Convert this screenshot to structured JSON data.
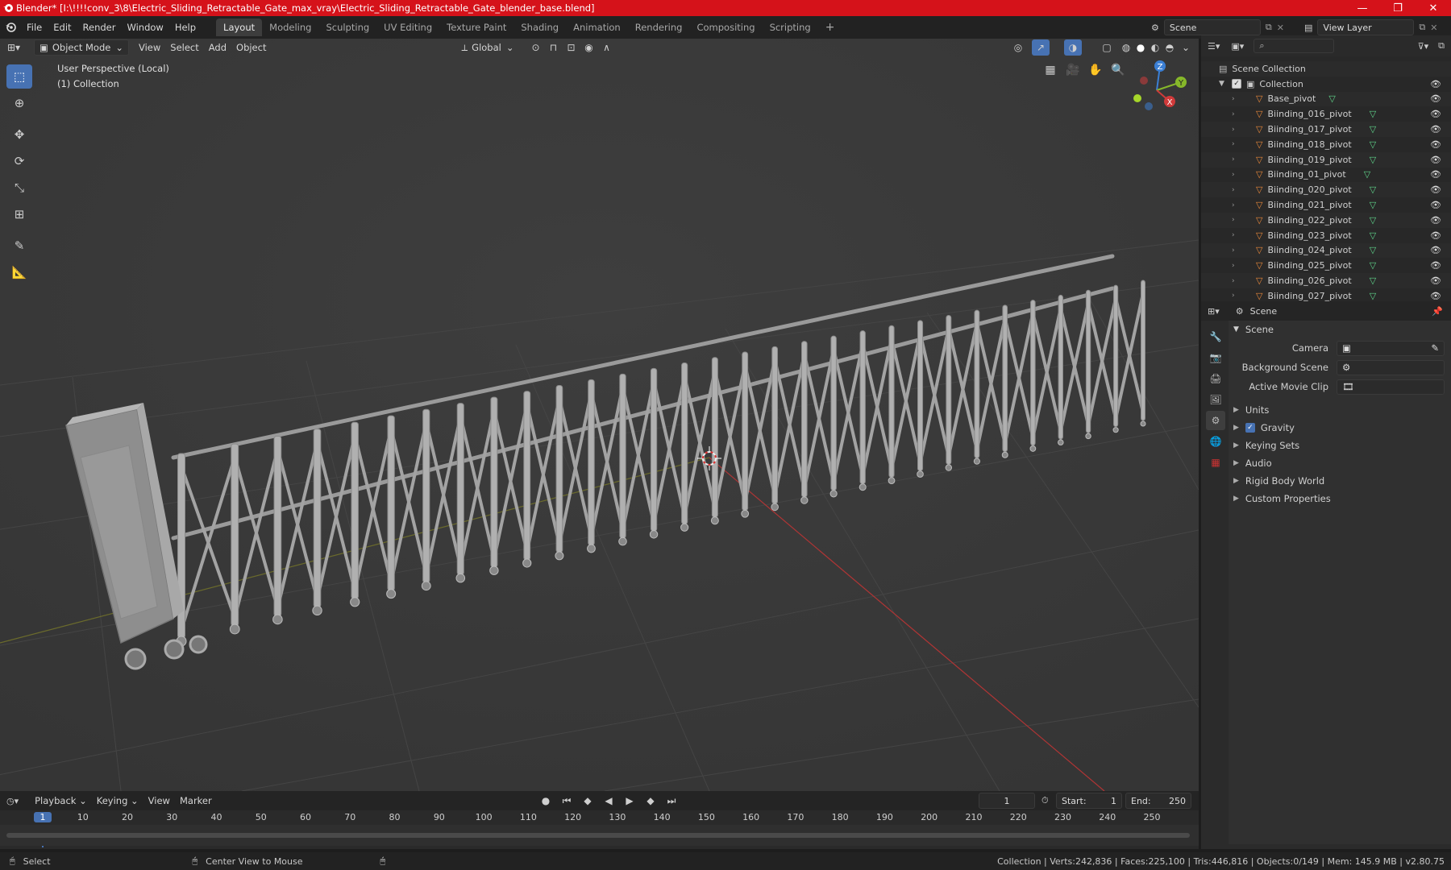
{
  "title_bar": {
    "text": "Blender* [I:\\!!!!conv_3\\8\\Electric_Sliding_Retractable_Gate_max_vray\\Electric_Sliding_Retractable_Gate_blender_base.blend]",
    "minimize": "—",
    "restore": "❐",
    "close": "✕"
  },
  "menu": [
    "File",
    "Edit",
    "Render",
    "Window",
    "Help"
  ],
  "workspaces": [
    "Layout",
    "Modeling",
    "Sculpting",
    "UV Editing",
    "Texture Paint",
    "Shading",
    "Animation",
    "Rendering",
    "Compositing",
    "Scripting"
  ],
  "workspace_add": "+",
  "scene_selector": "Scene",
  "view_layer_selector": "View Layer",
  "viewport": {
    "mode": "Object Mode",
    "menus": [
      "View",
      "Select",
      "Add",
      "Object"
    ],
    "orientation": "Global",
    "overlay_line1": "User Perspective (Local)",
    "overlay_line2": "(1) Collection",
    "gizmo_axes": {
      "z": "Z",
      "y": "Y",
      "x": "X"
    }
  },
  "outliner": {
    "scene_collection": "Scene Collection",
    "collection": "Collection",
    "items": [
      "Base_pivot",
      "Biinding_016_pivot",
      "Biinding_017_pivot",
      "Biinding_018_pivot",
      "Biinding_019_pivot",
      "Biinding_01_pivot",
      "Biinding_020_pivot",
      "Biinding_021_pivot",
      "Biinding_022_pivot",
      "Biinding_023_pivot",
      "Biinding_024_pivot",
      "Biinding_025_pivot",
      "Biinding_026_pivot",
      "Biinding_027_pivot"
    ]
  },
  "properties": {
    "context": "Scene",
    "section": "Scene",
    "fields": [
      {
        "label": "Camera"
      },
      {
        "label": "Background Scene"
      },
      {
        "label": "Active Movie Clip"
      }
    ],
    "panels": [
      "Units",
      "Gravity",
      "Keying Sets",
      "Audio",
      "Rigid Body World",
      "Custom Properties"
    ]
  },
  "timeline": {
    "menus": [
      "Playback",
      "Keying",
      "View",
      "Marker"
    ],
    "current_frame": "1",
    "start_label": "Start:",
    "start": "1",
    "end_label": "End:",
    "end": "250",
    "ticks": [
      "1",
      "10",
      "20",
      "30",
      "40",
      "50",
      "60",
      "70",
      "80",
      "90",
      "100",
      "110",
      "120",
      "130",
      "140",
      "150",
      "160",
      "170",
      "180",
      "190",
      "200",
      "210",
      "220",
      "230",
      "240",
      "250"
    ]
  },
  "status_bar": {
    "left": "Select",
    "middle": "Center View to Mouse",
    "stats": "Collection | Verts:242,836 | Faces:225,100 | Tris:446,816 | Objects:0/149 | Mem: 145.9 MB | v2.80.75"
  },
  "colors": {
    "title_bar": "#d5121a",
    "accent": "#4772b3",
    "object_icon": "#e8883a",
    "mesh_icon": "#5fd48a",
    "x_axis": "#c0392b",
    "y_axis": "#7cae2a"
  }
}
